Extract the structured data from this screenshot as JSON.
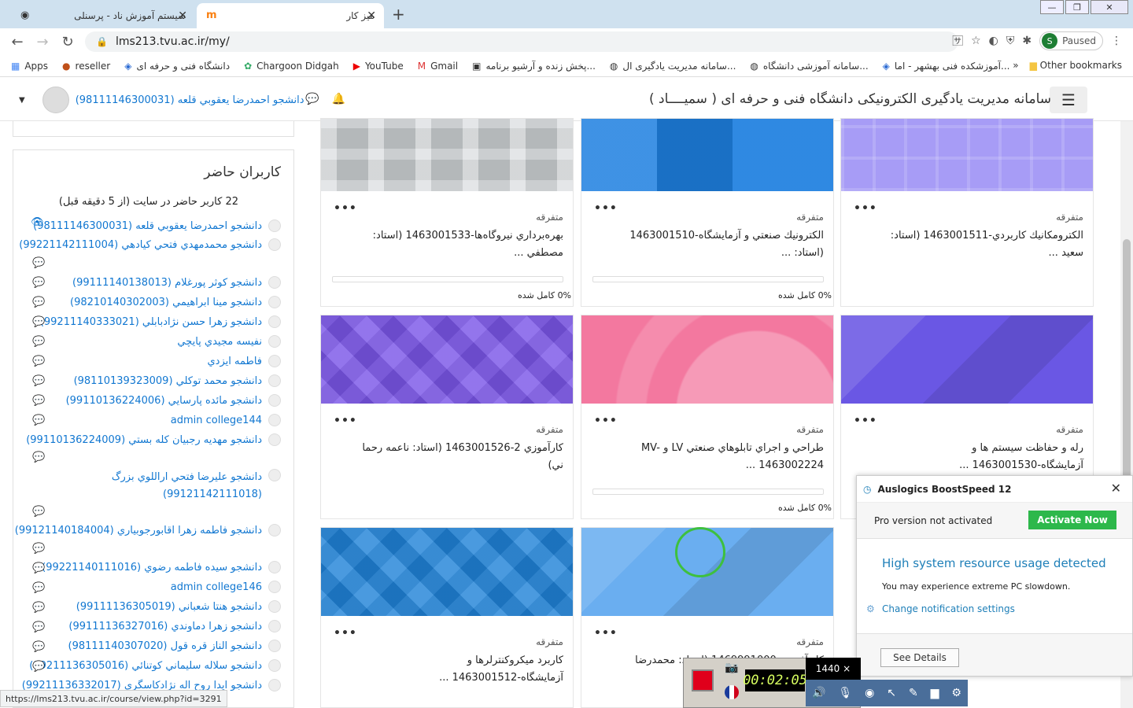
{
  "browser": {
    "tabs": [
      {
        "title": "سیستم آموزش ناد - پرسنلی",
        "icon": "chrome-icon"
      },
      {
        "title": "میز کار",
        "icon": "moodle-icon"
      }
    ],
    "url": "lms213.tvu.ac.ir/my/",
    "profile": "S",
    "profile_status": "Paused",
    "bookmarks": [
      "Apps",
      "reseller",
      "دانشگاه فنی و حرفه ای",
      "Chargoon Didgah",
      "YouTube",
      "Gmail",
      "پخش زنده و آرشیو برنامه...",
      "سامانه مدیریت یادگیری ال...",
      "سامانه آموزشی دانشگاه...",
      "آموزشکده فنی بهشهر - اما..."
    ],
    "other_bookmarks": "Other bookmarks",
    "more_bookmarks": "»"
  },
  "site": {
    "title": "سامانه مدیریت یادگیری الکترونیکی دانشگاه فنی و حرفه ای ( سمیــــاد )",
    "user": "دانشجو احمدرضا يعقوبي قلعه (98111146300031)"
  },
  "online_users": {
    "title": "کاربران حاضر",
    "count_text": "22 کاربر حاضر در سایت (از 5 دقیقه قبل)",
    "users": [
      "دانشجو احمدرضا يعقوبي قلعه (98111146300031)",
      "دانشجو محمدمهدي فتحي كيادهي (99221142111004)",
      "دانشجو كوثر پورغلام (99111140138013)",
      "دانشجو مينا ابراهيمي (98210140302003)",
      "دانشجو زهرا حسن نژادبابلي (99211140333021)",
      "نفيسه مجيدي پايچي",
      "فاطمه ايزدي",
      "دانشجو محمد توكلي (98110139323009)",
      "دانشجو مائده پارسايي (99110136224006)",
      "admin college144",
      "دانشجو مهديه رجبيان كله بستي (99110136224009)",
      "دانشجو عليرضا فتحي اراللوي بزرگ (99121142111018)",
      "دانشجو فاطمه زهرا اقابورجوبياري (99121140184004)",
      "دانشجو سيده فاطمه رضوي (99221140111016)",
      "admin college146",
      "دانشجو هنتا شعباني (99111136305019)",
      "دانشجو زهرا دماوندي (99111136327016)",
      "دانشجو الناز قره قول (98111140307020)",
      "دانشجو سلاله سليماني كوتنائي (99211136305016)",
      "دانشجو ايدا روح اله نژادكاسگري (99211136332017)"
    ]
  },
  "courses": [
    {
      "category": "متفرقه",
      "title": "بهره‌برداري نيروگاه‌ها-1463001533 (استاد: مصطفي ...",
      "progress": "0% کامل شده",
      "color": "#c8cccf",
      "pattern": "plaid"
    },
    {
      "category": "متفرقه",
      "title": "الکترونيك صنعتي و آزمايشگاه-1463001510 (استاد: ...",
      "progress": "0% کامل شده",
      "color": "#1d7fe0",
      "pattern": "squares"
    },
    {
      "category": "متفرقه",
      "title": "الکترومکانيك کاربردي-1463001511 (استاد: سعيد ...",
      "progress": "",
      "color": "#a79cf6",
      "pattern": "boxes"
    },
    {
      "category": "متفرقه",
      "title": "کارآموزي 2-1463001526 (استاد: ناعمه رحما ني)",
      "progress": "",
      "color": "#7a55e8",
      "pattern": "diamonds"
    },
    {
      "category": "متفرقه",
      "title": "طراحي و اجراي تابلوهاي صنعتي LV و MV-1463002224 ...",
      "progress": "0% کامل شده",
      "color": "#f3789f",
      "pattern": "waves"
    },
    {
      "category": "متفرقه",
      "title": "رله و حفاظت سيستم ها و آزمايشگاه-1463001530 ...",
      "progress": "",
      "color": "#6a57e4",
      "pattern": "triangles"
    },
    {
      "category": "متفرقه",
      "title": "کاربرد ميکروکنترلرها و آزمايشگاه-1463001512 ...",
      "progress": "",
      "color": "#1f82d8",
      "pattern": "diamonds"
    },
    {
      "category": "متفرقه",
      "title": "كل آفرينى-1469991000 (استاد: محمدرضا جبرئيل",
      "progress": "",
      "color": "#6aaef0",
      "pattern": "triangles"
    }
  ],
  "popup": {
    "app": "Auslogics BoostSpeed 12",
    "pro": "Pro version not activated",
    "activate": "Activate Now",
    "heading": "High system resource usage detected",
    "message": "You may experience extreme PC slowdown.",
    "settings": "Change notification settings",
    "details": "See Details"
  },
  "recorder": {
    "time": "00:02:05",
    "size": "1440 ×"
  },
  "status_url": "https://lms213.tvu.ac.ir/course/view.php?id=3291"
}
